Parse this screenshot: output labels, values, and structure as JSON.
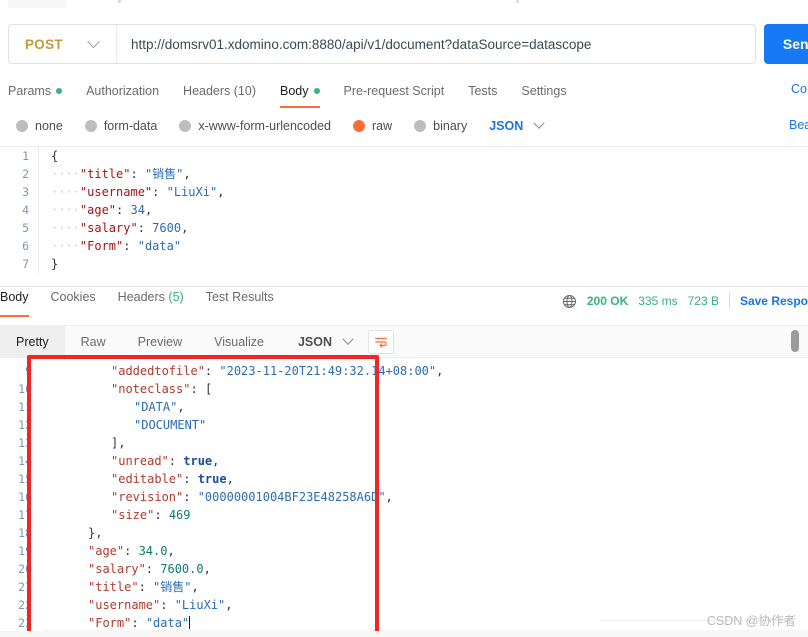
{
  "request": {
    "method": "POST",
    "url": "http://domsrv01.xdomino.com:8880/api/v1/document?dataSource=datascope",
    "send_label": "Send",
    "tabs": [
      {
        "label": "Params",
        "dot": true,
        "active": false
      },
      {
        "label": "Authorization",
        "dot": false,
        "active": false
      },
      {
        "label": "Headers (10)",
        "dot": false,
        "active": false
      },
      {
        "label": "Body",
        "dot": true,
        "active": true
      },
      {
        "label": "Pre-request Script",
        "dot": false,
        "active": false
      },
      {
        "label": "Tests",
        "dot": false,
        "active": false
      },
      {
        "label": "Settings",
        "dot": false,
        "active": false
      }
    ],
    "cookies_link": "Co",
    "beautify_link": "Beau",
    "body_types": [
      {
        "label": "none",
        "selected": false
      },
      {
        "label": "form-data",
        "selected": false
      },
      {
        "label": "x-www-form-urlencoded",
        "selected": false
      },
      {
        "label": "raw",
        "selected": true
      },
      {
        "label": "binary",
        "selected": false
      }
    ],
    "format": "JSON",
    "body_lines": [
      {
        "n": "1",
        "tokens": [
          {
            "t": "{",
            "c": "p"
          }
        ]
      },
      {
        "n": "2",
        "tokens": [
          {
            "t": "····",
            "c": "ind"
          },
          {
            "t": "\"title\"",
            "c": "k"
          },
          {
            "t": ": ",
            "c": "p"
          },
          {
            "t": "\"销售\"",
            "c": "s"
          },
          {
            "t": ",",
            "c": "p"
          }
        ]
      },
      {
        "n": "3",
        "tokens": [
          {
            "t": "····",
            "c": "ind"
          },
          {
            "t": "\"username\"",
            "c": "k"
          },
          {
            "t": ": ",
            "c": "p"
          },
          {
            "t": "\"LiuXi\"",
            "c": "s"
          },
          {
            "t": ",",
            "c": "p"
          }
        ]
      },
      {
        "n": "4",
        "tokens": [
          {
            "t": "····",
            "c": "ind"
          },
          {
            "t": "\"age\"",
            "c": "k"
          },
          {
            "t": ": ",
            "c": "p"
          },
          {
            "t": "34",
            "c": "n2"
          },
          {
            "t": ",",
            "c": "p"
          }
        ]
      },
      {
        "n": "5",
        "tokens": [
          {
            "t": "····",
            "c": "ind"
          },
          {
            "t": "\"salary\"",
            "c": "k"
          },
          {
            "t": ": ",
            "c": "p"
          },
          {
            "t": "7600",
            "c": "n2"
          },
          {
            "t": ",",
            "c": "p"
          }
        ]
      },
      {
        "n": "6",
        "tokens": [
          {
            "t": "····",
            "c": "ind"
          },
          {
            "t": "\"Form\"",
            "c": "k"
          },
          {
            "t": ": ",
            "c": "p"
          },
          {
            "t": "\"data\"",
            "c": "s"
          }
        ]
      },
      {
        "n": "7",
        "tokens": [
          {
            "t": "}",
            "c": "p"
          }
        ]
      }
    ]
  },
  "response": {
    "tabs": [
      {
        "label": "Body",
        "count": "",
        "active": true
      },
      {
        "label": "Cookies",
        "count": "",
        "active": false
      },
      {
        "label": "Headers ",
        "count": "(5)",
        "active": false
      },
      {
        "label": "Test Results",
        "count": "",
        "active": false
      }
    ],
    "status": "200 OK",
    "time": "335 ms",
    "size": "723 B",
    "save_label": "Save Respo",
    "view_tabs": [
      {
        "label": "Pretty",
        "active": true
      },
      {
        "label": "Raw",
        "active": false
      },
      {
        "label": "Preview",
        "active": false
      },
      {
        "label": "Visualize",
        "active": false
      }
    ],
    "format": "JSON",
    "body_lines": [
      {
        "n": "9",
        "indent": 3,
        "tokens": [
          {
            "t": "\"addedtofile\"",
            "c": "k2"
          },
          {
            "t": ": ",
            "c": "p"
          },
          {
            "t": "\"2023-11-20T21:49:32.14+08:00\"",
            "c": "s"
          },
          {
            "t": ",",
            "c": "p"
          }
        ]
      },
      {
        "n": "10",
        "indent": 3,
        "tokens": [
          {
            "t": "\"noteclass\"",
            "c": "k2"
          },
          {
            "t": ": ",
            "c": "p"
          },
          {
            "t": "[",
            "c": "p"
          }
        ]
      },
      {
        "n": "11",
        "indent": 4,
        "tokens": [
          {
            "t": "\"DATA\"",
            "c": "s"
          },
          {
            "t": ",",
            "c": "p"
          }
        ]
      },
      {
        "n": "12",
        "indent": 4,
        "tokens": [
          {
            "t": "\"DOCUMENT\"",
            "c": "s"
          }
        ]
      },
      {
        "n": "13",
        "indent": 3,
        "tokens": [
          {
            "t": "],",
            "c": "p"
          }
        ]
      },
      {
        "n": "14",
        "indent": 3,
        "tokens": [
          {
            "t": "\"unread\"",
            "c": "k2"
          },
          {
            "t": ": ",
            "c": "p"
          },
          {
            "t": "true",
            "c": "b"
          },
          {
            "t": ",",
            "c": "p"
          }
        ]
      },
      {
        "n": "15",
        "indent": 3,
        "tokens": [
          {
            "t": "\"editable\"",
            "c": "k2"
          },
          {
            "t": ": ",
            "c": "p"
          },
          {
            "t": "true",
            "c": "b"
          },
          {
            "t": ",",
            "c": "p"
          }
        ]
      },
      {
        "n": "16",
        "indent": 3,
        "tokens": [
          {
            "t": "\"revision\"",
            "c": "k2"
          },
          {
            "t": ": ",
            "c": "p"
          },
          {
            "t": "\"00000001004BF23E48258A6D\"",
            "c": "s"
          },
          {
            "t": ",",
            "c": "p"
          }
        ]
      },
      {
        "n": "17",
        "indent": 3,
        "tokens": [
          {
            "t": "\"size\"",
            "c": "k2"
          },
          {
            "t": ": ",
            "c": "p"
          },
          {
            "t": "469",
            "c": "n"
          }
        ]
      },
      {
        "n": "18",
        "indent": 2,
        "tokens": [
          {
            "t": "},",
            "c": "p"
          }
        ]
      },
      {
        "n": "19",
        "indent": 2,
        "tokens": [
          {
            "t": "\"age\"",
            "c": "k2"
          },
          {
            "t": ": ",
            "c": "p"
          },
          {
            "t": "34.0",
            "c": "n"
          },
          {
            "t": ",",
            "c": "p"
          }
        ]
      },
      {
        "n": "20",
        "indent": 2,
        "tokens": [
          {
            "t": "\"salary\"",
            "c": "k2"
          },
          {
            "t": ": ",
            "c": "p"
          },
          {
            "t": "7600.0",
            "c": "n"
          },
          {
            "t": ",",
            "c": "p"
          }
        ]
      },
      {
        "n": "21",
        "indent": 2,
        "tokens": [
          {
            "t": "\"title\"",
            "c": "k2"
          },
          {
            "t": ": ",
            "c": "p"
          },
          {
            "t": "\"销售\"",
            "c": "s"
          },
          {
            "t": ",",
            "c": "p"
          }
        ]
      },
      {
        "n": "22",
        "indent": 2,
        "tokens": [
          {
            "t": "\"username\"",
            "c": "k2"
          },
          {
            "t": ": ",
            "c": "p"
          },
          {
            "t": "\"LiuXi\"",
            "c": "s"
          },
          {
            "t": ",",
            "c": "p"
          }
        ]
      },
      {
        "n": "23",
        "indent": 2,
        "tokens": [
          {
            "t": "\"Form\"",
            "c": "k2"
          },
          {
            "t": ": ",
            "c": "p"
          },
          {
            "t": "\"data\"",
            "c": "s"
          },
          {
            "t": "",
            "c": "caret"
          }
        ]
      }
    ]
  },
  "annotation": {
    "color": "#f02626"
  },
  "watermark": "CSDN @协作者"
}
